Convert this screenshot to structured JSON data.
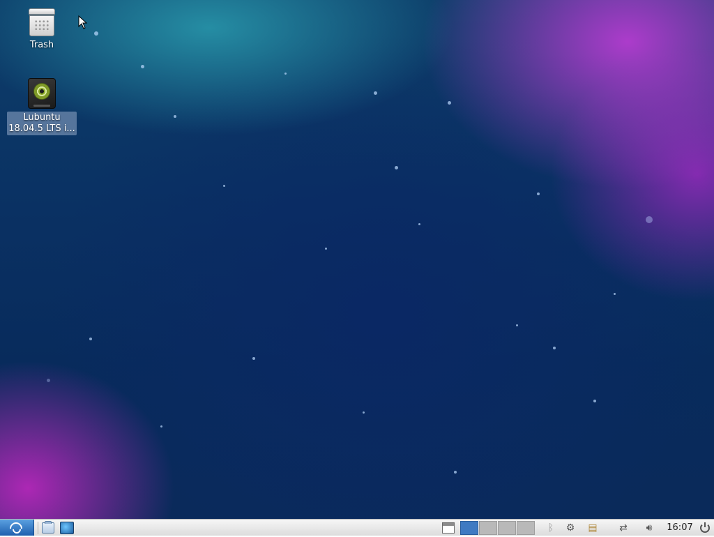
{
  "desktop": {
    "icons": [
      {
        "label": "Trash",
        "icon": "trash-icon"
      },
      {
        "label": "Lubuntu\n18.04.5 LTS i...",
        "icon": "disc-drive-icon"
      }
    ]
  },
  "taskbar": {
    "start_icon": "lubuntu-menu-icon",
    "launchers": [
      {
        "icon": "file-manager-icon"
      },
      {
        "icon": "terminal-icon"
      }
    ],
    "show_desktop_icon": "window-icon",
    "workspaces": {
      "count": 4,
      "active": 1
    },
    "tray": {
      "bluetooth_icon": "bluetooth-icon",
      "network_icon": "network-settings-icon",
      "clipboard_icon": "clipboard-icon",
      "display_icon": "display-icon",
      "volume_icon": "volume-icon"
    },
    "clock": "16:07",
    "power_icon": "power-icon"
  }
}
